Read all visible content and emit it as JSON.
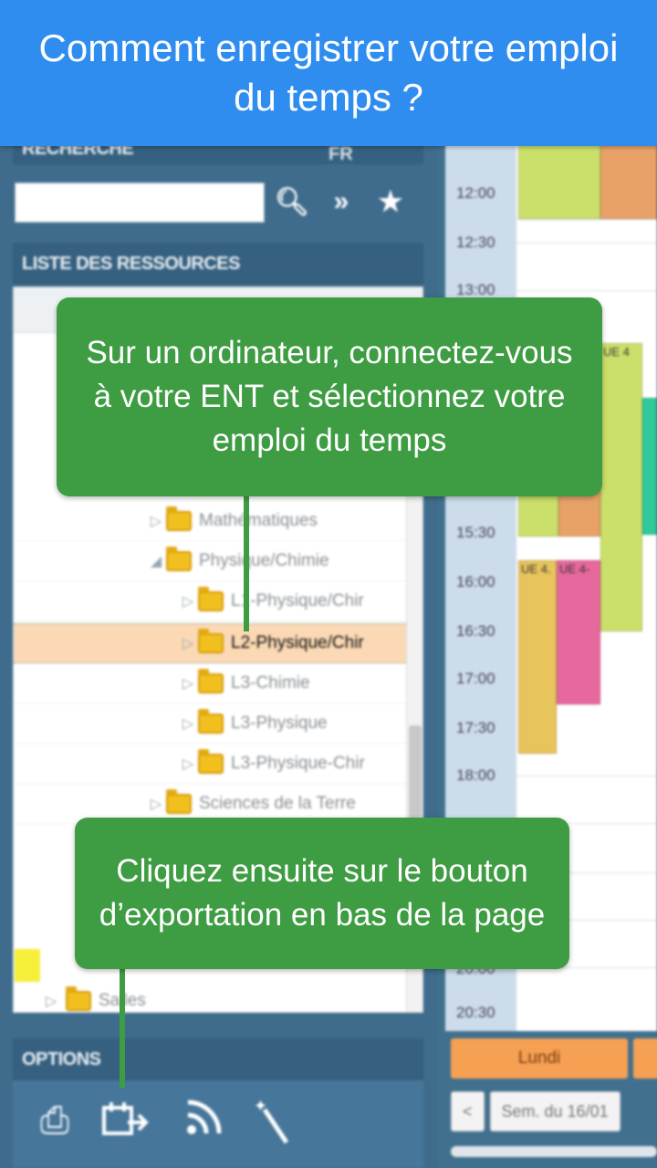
{
  "banner": {
    "title": "Comment enregistrer votre emploi du temps ?"
  },
  "callouts": {
    "step1": "Sur un ordinateur, connectez-vous à votre ENT et sélectionnez votre emploi du temps",
    "step2": "Cliquez ensuite sur le bouton d’exportation en bas de la page"
  },
  "search": {
    "heading": "RECHERCHE",
    "language": "FR",
    "value": ""
  },
  "resources": {
    "heading": "LISTE DES RESSOURCES",
    "items": [
      {
        "label": "Mathématiques",
        "expanded": false
      },
      {
        "label": "Physique/Chimie",
        "expanded": true
      },
      {
        "label": "L1-Physique/Chir",
        "expanded": false
      },
      {
        "label": "L2-Physique/Chir",
        "expanded": false,
        "selected": true
      },
      {
        "label": "L3-Chimie",
        "expanded": false
      },
      {
        "label": "L3-Physique",
        "expanded": false
      },
      {
        "label": "L3-Physique-Chir",
        "expanded": false
      },
      {
        "label": "Sciences de la Terre",
        "expanded": false
      },
      {
        "label": "Salles",
        "expanded": false
      }
    ]
  },
  "options": {
    "heading": "OPTIONS",
    "icons": [
      "print-icon",
      "export-calendar-icon",
      "rss-icon",
      "magic-wand-icon"
    ]
  },
  "calendar": {
    "times": [
      "12:00",
      "12:30",
      "13:00",
      "15:30",
      "16:00",
      "16:30",
      "17:00",
      "17:30",
      "18:00",
      "20:00",
      "20:30"
    ],
    "events": [
      "UE 4",
      "UE 4.",
      "UE 4-"
    ],
    "day": "Lundi",
    "prev": "<",
    "week": "Sem. du 16/01"
  },
  "colors": {
    "banner": "#2f8df0",
    "callout": "#3e9c42",
    "selected_row": "#fbd9b4",
    "day_button": "#f6a053"
  }
}
